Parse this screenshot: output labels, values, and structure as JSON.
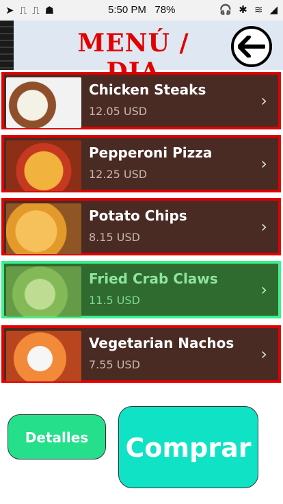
{
  "status_bar": {
    "time": "5:50 PM",
    "battery": "78%",
    "left_icons": [
      "nav-icon",
      "usb-icon",
      "usb-icon",
      "android-icon"
    ],
    "right_icons": [
      "headphones-icon",
      "bluetooth-icon",
      "wifi-icon",
      "signal-icon"
    ]
  },
  "header": {
    "title": "MENÚ / DIA",
    "accent_color": "#e30000"
  },
  "menu": {
    "items": [
      {
        "name": "Chicken Steaks",
        "price": "12.05 USD"
      },
      {
        "name": "Pepperoni Pizza",
        "price": "12.25 USD"
      },
      {
        "name": "Potato Chips",
        "price": "8.15 USD"
      },
      {
        "name": "Fried Crab Claws",
        "price": "11.5 USD"
      },
      {
        "name": "Vegetarian Nachos",
        "price": "7.55 USD"
      }
    ],
    "selected_index": 3
  },
  "actions": {
    "details_label": "Detalles",
    "buy_label": "Comprar"
  }
}
